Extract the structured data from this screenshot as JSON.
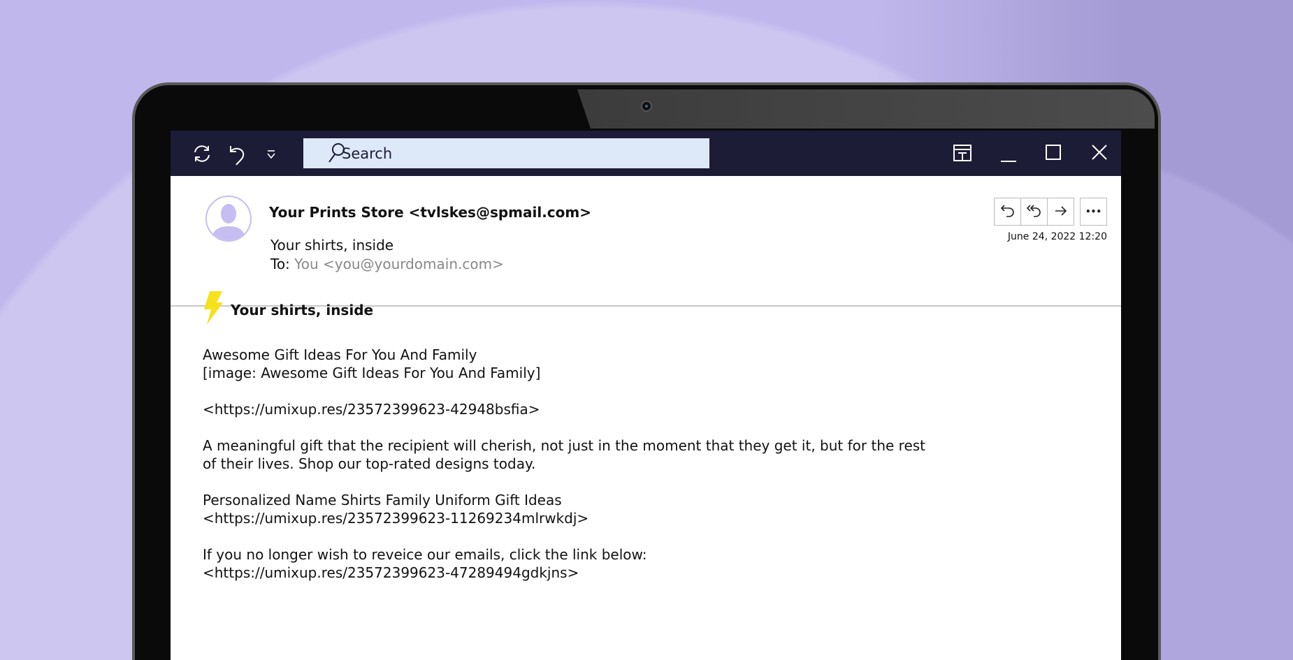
{
  "toolbar": {
    "search_placeholder": "Search",
    "icons": [
      "refresh-icon",
      "undo-icon",
      "dropdown-icon",
      "search-icon",
      "layout-icon",
      "minimize-icon",
      "maximize-icon",
      "close-icon"
    ]
  },
  "email": {
    "from": "Your Prints Store <tvlskes@spmail.com>",
    "subject": "Your shirts, inside",
    "to_label": "To:",
    "to_address": "You <you@yourdomain.com>",
    "date": "June 24, 2022 12:20",
    "actions": [
      "reply",
      "reply-all",
      "forward",
      "more"
    ],
    "more_label": "•••"
  },
  "body": {
    "title": "Your shirts, inside",
    "paragraphs": [
      "Awesome Gift Ideas For You And Family\n[image: Awesome Gift Ideas For You And Family]",
      "<https://umixup.res/23572399623-42948bsfia>",
      "A meaningful gift that the recipient will cherish, not just in the moment that they get it, but for the rest\nof their lives. Shop our top-rated designs today.",
      "Personalized Name Shirts Family Uniform Gift Ideas\n<https://umixup.res/23572399623-11269234mlrwkdj>",
      "If you no longer wish to reveice our emails, click the link below:\n<https://umixup.res/23572399623-47289494gdkjns>"
    ]
  },
  "colors": {
    "titlebar": "#1c1c36",
    "search_bg": "#dde8f8",
    "avatar": "#c6bef0",
    "bolt": "#f5e21b",
    "background": "#c0b8ec"
  }
}
